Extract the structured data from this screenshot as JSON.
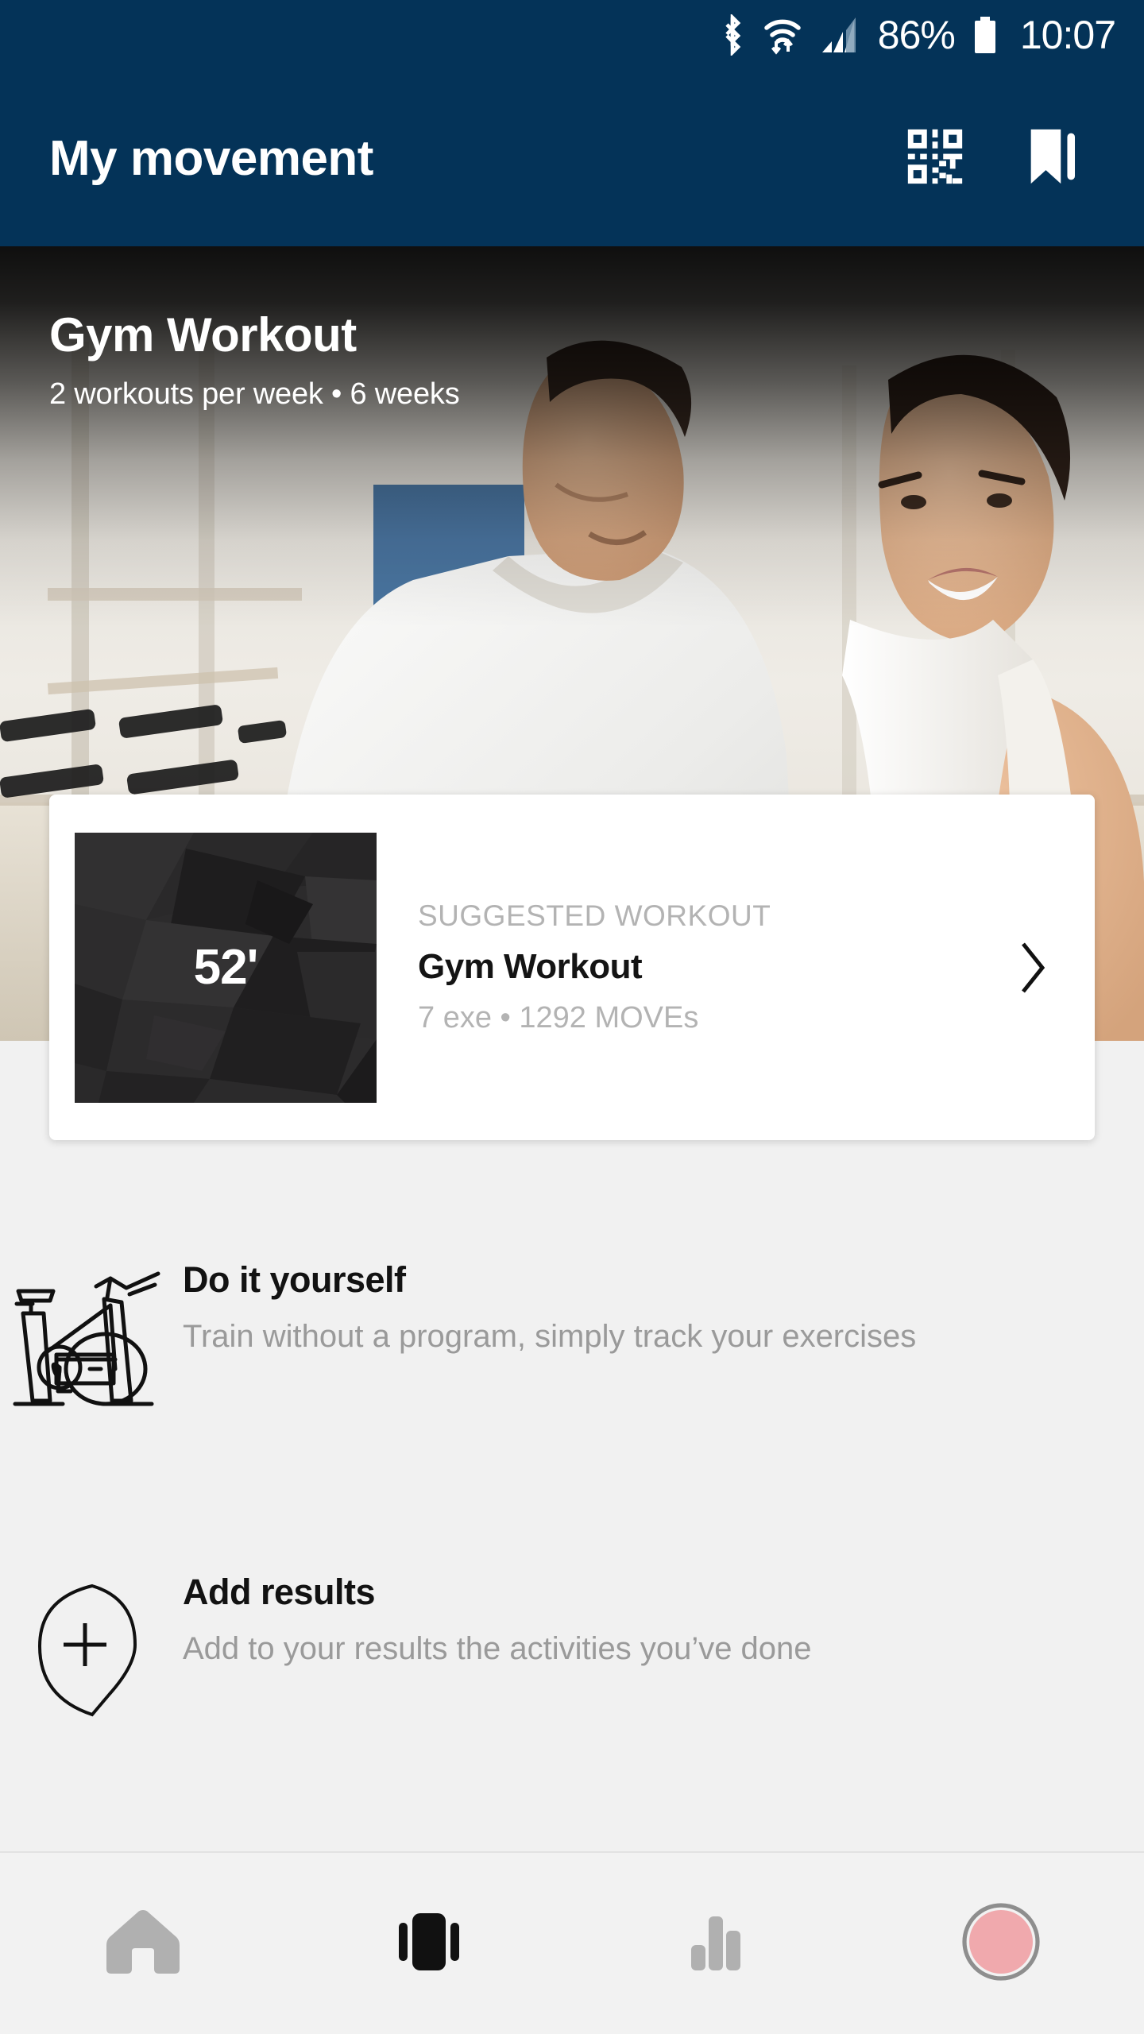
{
  "status_bar": {
    "battery_percent": "86%",
    "time": "10:07",
    "icons": [
      "bluetooth-icon",
      "wifi-icon",
      "cellular-signal-icon",
      "battery-icon"
    ]
  },
  "app_bar": {
    "title": "My movement",
    "actions": [
      "qr-code-icon",
      "bookmark-icon"
    ],
    "background_color": "#043358"
  },
  "hero": {
    "title": "Gym Workout",
    "subtitle": "2 workouts per week • 6 weeks"
  },
  "suggested_card": {
    "duration": "52'",
    "eyebrow": "SUGGESTED WORKOUT",
    "title": "Gym Workout",
    "meta": "7 exe • 1292 MOVEs",
    "chevron": "chevron-right-icon"
  },
  "options": [
    {
      "icon": "exercise-bike-icon",
      "title": "Do it yourself",
      "description": "Train without a program, simply track your exercises"
    },
    {
      "icon": "add-pin-icon",
      "title": "Add results",
      "description": "Add to your results the activities you’ve done"
    }
  ],
  "bottom_nav": {
    "items": [
      {
        "name": "home",
        "icon": "home-icon",
        "active": false
      },
      {
        "name": "workouts",
        "icon": "cards-carousel-icon",
        "active": true
      },
      {
        "name": "stats",
        "icon": "bar-chart-icon",
        "active": false
      },
      {
        "name": "profile",
        "icon": "avatar-icon",
        "active": false
      }
    ],
    "active_color": "#111111",
    "inactive_color": "#b0b0b0",
    "avatar_color": "#f0a9ad"
  },
  "colors": {
    "primary_navy": "#043358",
    "page_background": "#f1f1f1",
    "card_background": "#ffffff",
    "muted_text": "#b3b3b3"
  }
}
